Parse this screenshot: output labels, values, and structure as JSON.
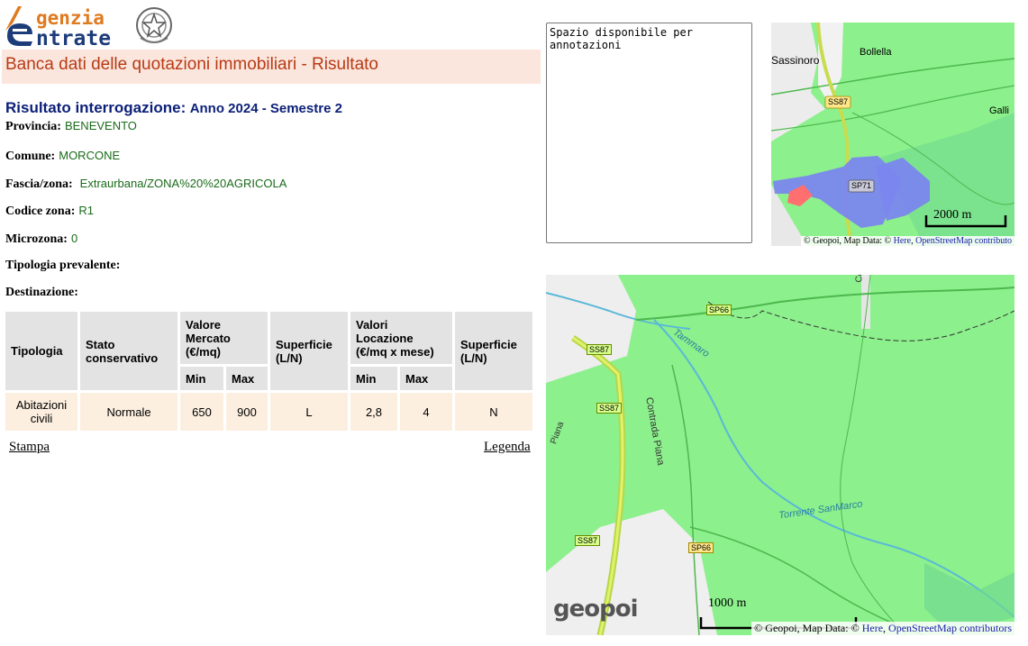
{
  "logo": {
    "line1": "genzia",
    "line2": "ntrate"
  },
  "title_bar": "Banca dati delle quotazioni immobiliari - Risultato",
  "result": {
    "heading_label": "Risultato interrogazione:",
    "heading_value": "Anno 2024 - Semestre 2",
    "provincia_label": "Provincia:",
    "provincia": "BENEVENTO",
    "comune_label": "Comune:",
    "comune": "MORCONE",
    "fascia_label": "Fascia/zona:",
    "fascia": "Extraurbana/ZONA%20%20AGRICOLA",
    "codice_label": "Codice zona:",
    "codice": "R1",
    "microzona_label": "Microzona:",
    "microzona": "0",
    "tipologia_prevalente_label": "Tipologia prevalente:",
    "destinazione_label": "Destinazione:"
  },
  "table": {
    "headers": {
      "tipologia": "Tipologia",
      "stato": "Stato conservativo",
      "valore_mercato": "Valore Mercato (€/mq)",
      "superficie": "Superficie (L/N)",
      "valori_locazione": "Valori Locazione (€/mq x mese)",
      "superficie2": "Superficie (L/N)",
      "min": "Min",
      "max": "Max"
    },
    "row": {
      "tipologia": "Abitazioni civili",
      "stato": "Normale",
      "vm_min": "650",
      "vm_max": "900",
      "superficie": "L",
      "loc_min": "2,8",
      "loc_max": "4",
      "superficie2": "N"
    }
  },
  "links": {
    "stampa": "Stampa",
    "legenda": "Legenda"
  },
  "notes": {
    "text": "Spazio disponibile per annotazioni"
  },
  "map_small": {
    "labels": {
      "sassinoro": "Sassinoro",
      "bollella": "Bollella",
      "galli": "Galli",
      "road1": "SS87",
      "road2": "SP71"
    },
    "scale": "2000 m",
    "attrib_prefix": "© Geopoi, Map Data: ©",
    "attrib_here": "Here",
    "attrib_osm": "OpenStreetMap contributo"
  },
  "map_large": {
    "labels": {
      "sp66_top": "SP66",
      "ss87_a": "SS87",
      "ss87_b": "SS87",
      "ss87_c": "SS87",
      "sp66_bottom": "SP66",
      "tammaro": "Tammaro",
      "contrada_piana": "Contrada Piana",
      "piana": "Piana",
      "torrente": "Torrente SanMarco",
      "contrad": "Contrad"
    },
    "scale": "1000 m",
    "brand": "geopoi",
    "attrib_prefix": "© Geopoi, Map Data: ©",
    "attrib_here": "Here",
    "attrib_osm": "OpenStreetMap contributors"
  },
  "colors": {
    "title_bg": "#fbe6de",
    "title_text": "#b83a14",
    "heading": "#0b1f78",
    "value_green": "#1a6b1a",
    "map_green": "#8cf08c"
  }
}
